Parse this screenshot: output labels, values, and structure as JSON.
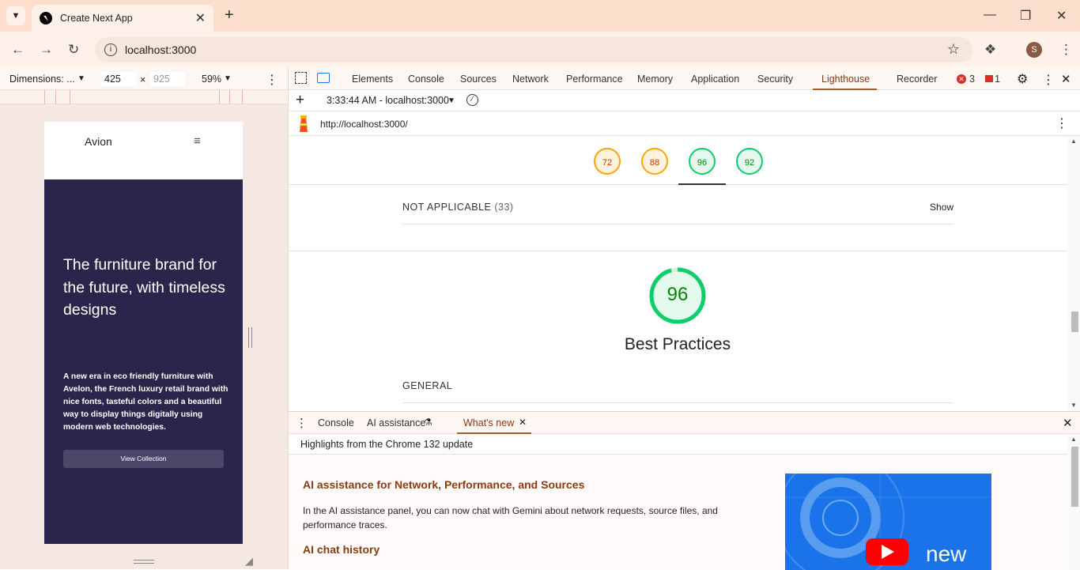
{
  "browser": {
    "tab_title": "Create Next App",
    "url": "localhost:3000",
    "avatar_letter": "S"
  },
  "device_toolbar": {
    "dimensions_label": "Dimensions: ...",
    "width": "425",
    "height_placeholder": "925",
    "times": "×",
    "zoom": "59%"
  },
  "preview": {
    "brand": "Avion",
    "menu_icon": "≡",
    "headline": "The furniture brand for the future, with timeless designs",
    "body": "A new era in eco friendly furniture with Avelon, the French luxury retail brand with nice fonts, tasteful colors and a beautiful way to display things digitally using modern web technologies.",
    "cta": "View Collection"
  },
  "devtools": {
    "tabs": [
      "Elements",
      "Console",
      "Sources",
      "Network",
      "Performance",
      "Memory",
      "Application",
      "Security",
      "Lighthouse",
      "Recorder"
    ],
    "active_tab": "Lighthouse",
    "errors": "3",
    "warnings": "1",
    "report_selector": "3:33:44 AM - localhost:3000",
    "report_url": "http://localhost:3000/"
  },
  "lighthouse": {
    "scores": [
      {
        "value": "72",
        "color": "#ffa400"
      },
      {
        "value": "88",
        "color": "#ffa400"
      },
      {
        "value": "96",
        "color": "#0cce6b"
      },
      {
        "value": "92",
        "color": "#0cce6b"
      }
    ],
    "not_applicable_label": "NOT APPLICABLE",
    "not_applicable_count": "(33)",
    "show_label": "Show",
    "big_score": "96",
    "category_title": "Best Practices",
    "section_label": "GENERAL",
    "pass_color": "#0cce6b",
    "average_color": "#ffa400"
  },
  "drawer": {
    "tabs": [
      "Console",
      "AI assistance",
      "What's new"
    ],
    "active_tab": "What's new",
    "highlight": "Highlights from the Chrome 132 update",
    "feature_title": "AI assistance for Network, Performance, and Sources",
    "feature_body": "In the AI assistance panel, you can now chat with Gemini about network requests, source files, and performance traces.",
    "next_title": "AI chat history",
    "video_word": "new"
  }
}
